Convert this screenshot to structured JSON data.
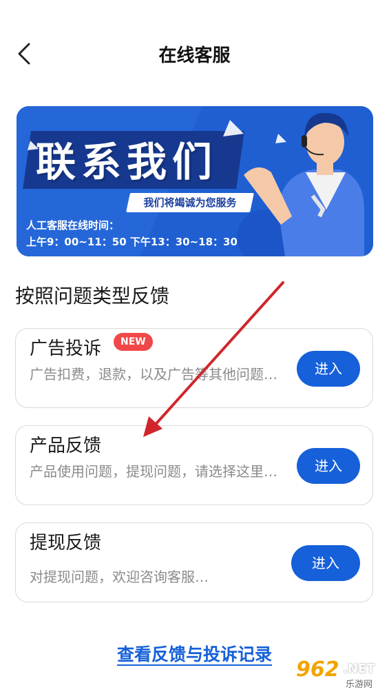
{
  "nav": {
    "title": "在线客服",
    "back_icon": "chevron-left-icon"
  },
  "banner": {
    "title": "联系我们",
    "slogan": "我们将竭诚为您服务",
    "hours_label": "人工客服在线时间：",
    "hours": "上午9：00~11：50  下午13：30~18：30",
    "colors": {
      "background": "#1f5fd1",
      "dark": "#16398f"
    }
  },
  "section": {
    "title": "按照问题类型反馈"
  },
  "cards": [
    {
      "title": "广告投诉",
      "badge": "NEW",
      "desc": "广告扣费，退款，以及广告等其他问题…",
      "button": "进入"
    },
    {
      "title": "产品反馈",
      "desc": "产品使用问题，提现问题，请选择这里…",
      "button": "进入"
    },
    {
      "title": "提现反馈",
      "desc": "对提现问题，欢迎咨询客服…",
      "button": "进入"
    }
  ],
  "records_link": "查看反馈与投诉记录",
  "watermark": {
    "num": "962",
    "net": ".NET",
    "cn": "乐游网"
  },
  "colors": {
    "accent": "#1660d9",
    "badge": "#f04848",
    "arrow": "#d0262b"
  }
}
